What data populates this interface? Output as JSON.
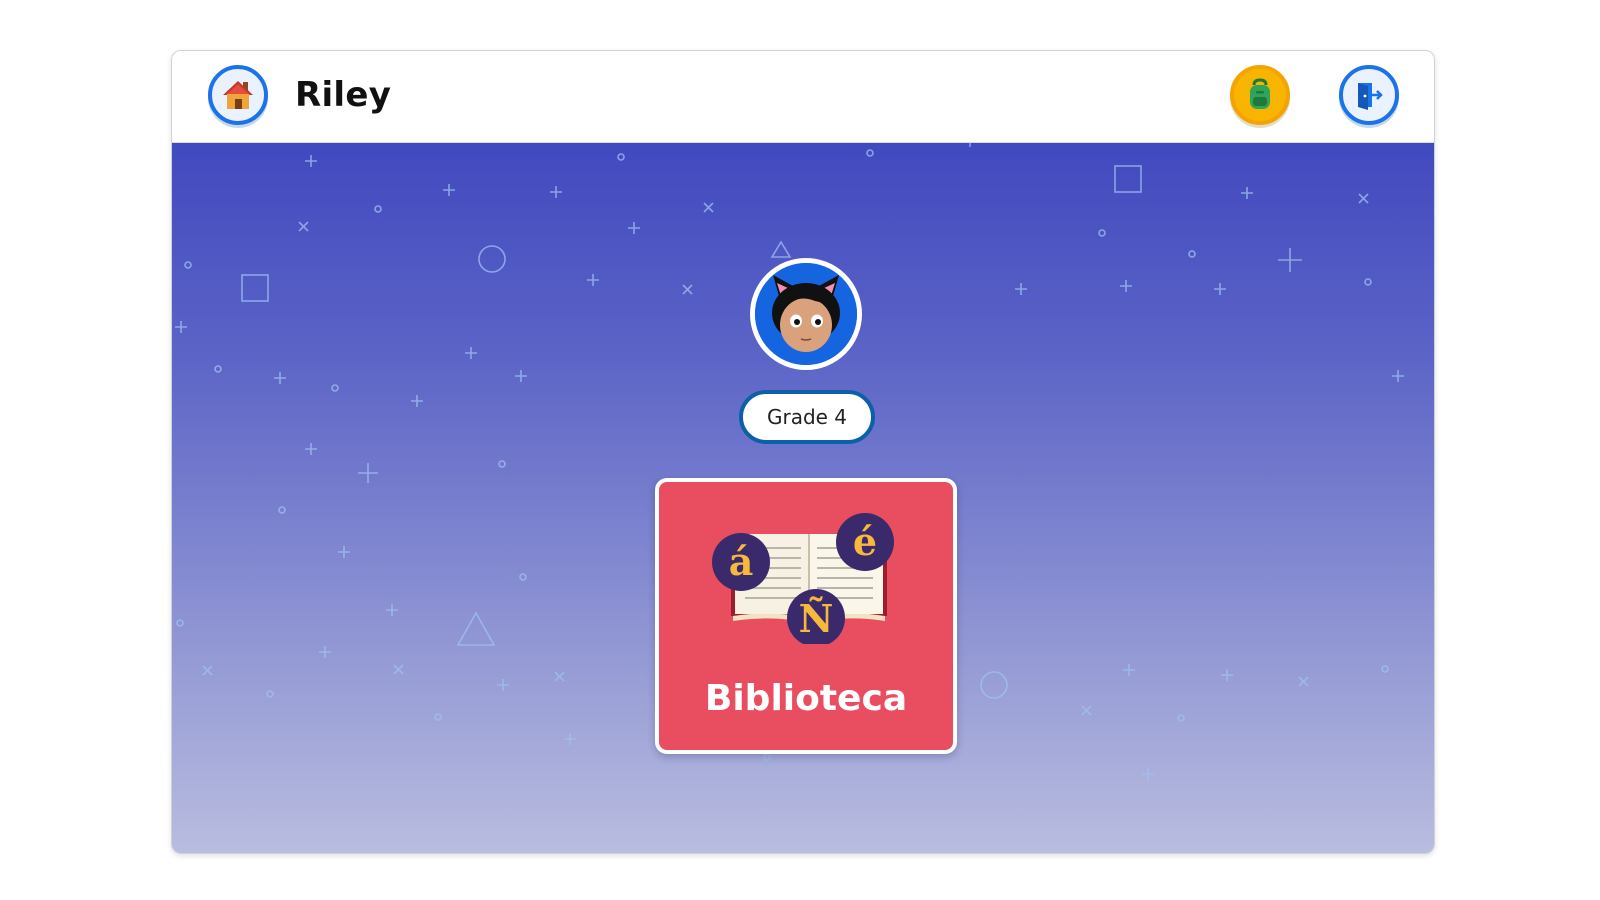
{
  "header": {
    "student_name": "Riley",
    "home_icon": "house-icon",
    "backpack_icon": "backpack-icon",
    "exit_icon": "exit-door-icon"
  },
  "profile": {
    "avatar_icon": "cat-ear-kid-avatar",
    "grade_label": "Grade 4"
  },
  "activities": [
    {
      "label": "Biblioteca",
      "icon": "open-book-accented-letters-icon",
      "letters": [
        "á",
        "é",
        "Ñ"
      ],
      "card_color": "#e84d60"
    }
  ],
  "colors": {
    "accent_blue": "#1a73e8",
    "backpack_orange": "#f7b500",
    "background_top": "#4149bf",
    "background_bottom": "#b9bddf",
    "letter_bubble": "#3b2a6b",
    "letter_gold": "#f6b93b"
  }
}
